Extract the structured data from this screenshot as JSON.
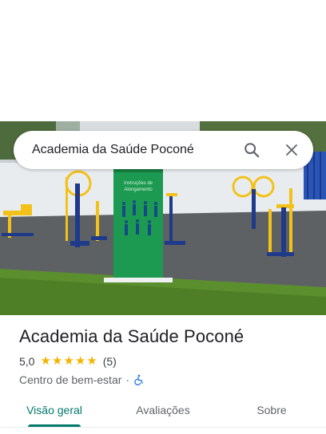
{
  "search": {
    "query": "Academia da Saúde Poconé"
  },
  "icons": {
    "search": "search-icon",
    "close": "close-icon",
    "accessibility": "wheelchair-accessible-icon",
    "star": "star-icon"
  },
  "place": {
    "name": "Academia da Saúde Poconé",
    "rating": "5,0",
    "stars": 5,
    "review_count": "(5)",
    "category": "Centro de bem-estar",
    "separator": "·"
  },
  "tabs": [
    {
      "label": "Visão geral",
      "active": true
    },
    {
      "label": "Avaliações",
      "active": false
    },
    {
      "label": "Sobre",
      "active": false
    }
  ],
  "photo": {
    "sign_line1": "Instruções de",
    "sign_line2": "Alongamento"
  },
  "colors": {
    "accent": "#00796b",
    "star": "#f4b400",
    "sign_green": "#1c9a52",
    "equipment_yellow": "#f2c21b",
    "equipment_blue": "#1f3a8a"
  }
}
